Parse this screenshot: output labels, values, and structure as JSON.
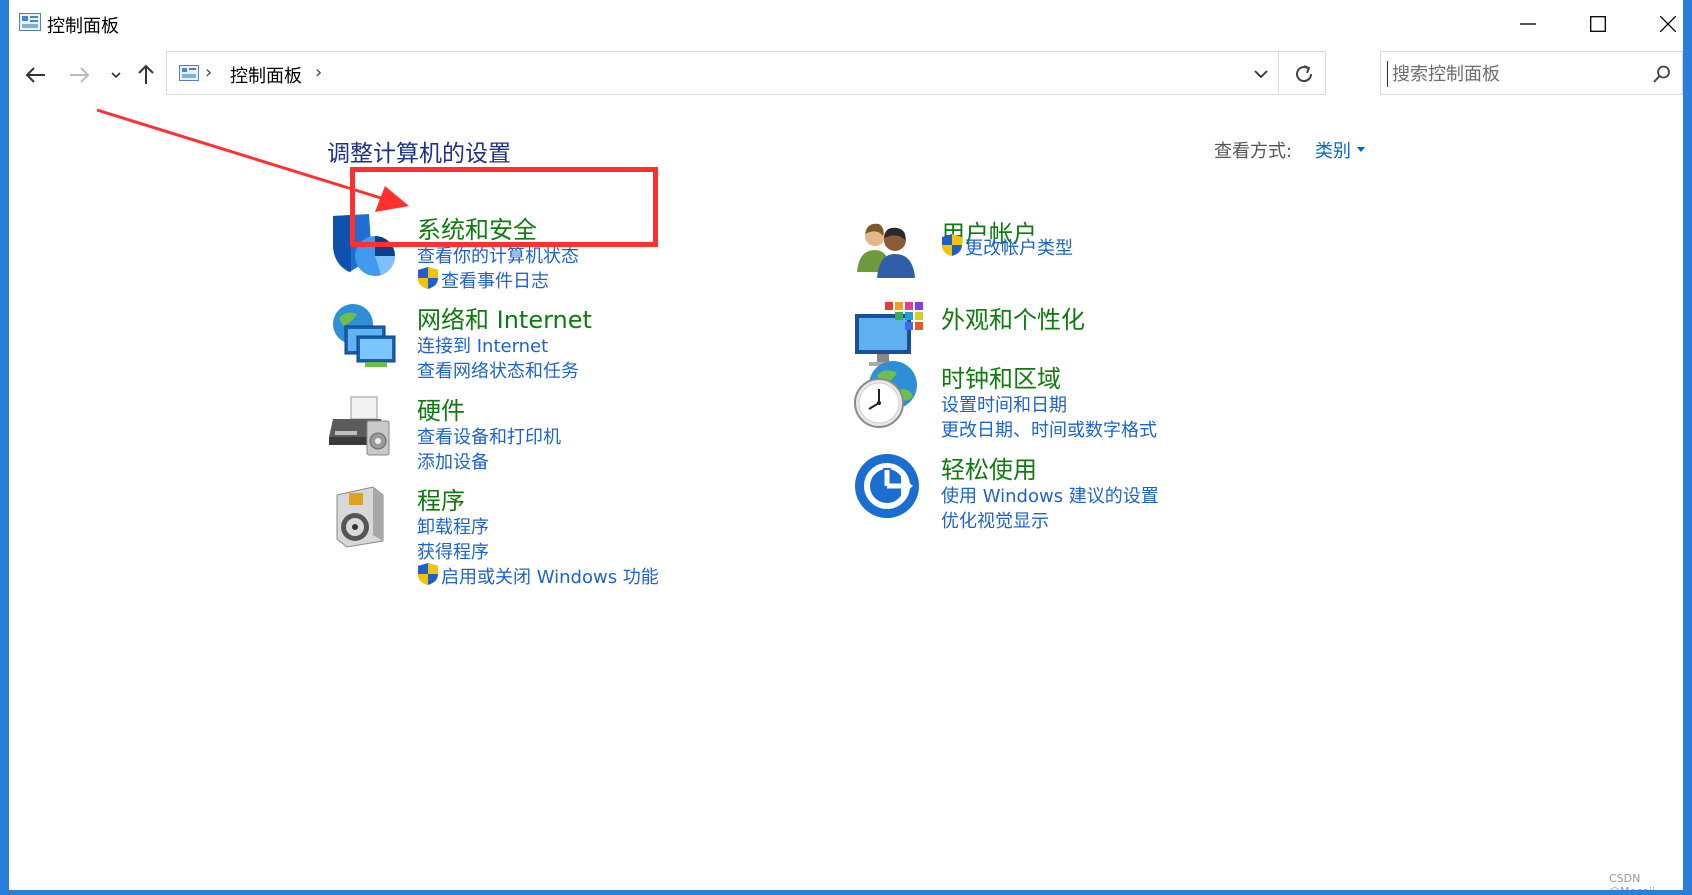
{
  "window": {
    "title": "控制面板",
    "controls": {
      "minimize": "minimize",
      "maximize": "maximize",
      "close": "close"
    }
  },
  "navbar": {
    "breadcrumb": "控制面板",
    "search_placeholder": "搜索控制面板"
  },
  "main": {
    "heading": "调整计算机的设置",
    "view_by_label": "查看方式:",
    "view_by_value": "类别"
  },
  "categories": [
    {
      "title": "系统和安全",
      "icon": "system-security-icon",
      "links": [
        {
          "label": "查看你的计算机状态",
          "shield": false
        },
        {
          "label": "查看事件日志",
          "shield": true
        }
      ]
    },
    {
      "title": "网络和 Internet",
      "icon": "network-internet-icon",
      "links": [
        {
          "label": "连接到 Internet",
          "shield": false
        },
        {
          "label": "查看网络状态和任务",
          "shield": false
        }
      ]
    },
    {
      "title": "硬件",
      "icon": "hardware-printer-icon",
      "links": [
        {
          "label": "查看设备和打印机",
          "shield": false
        },
        {
          "label": "添加设备",
          "shield": false
        }
      ]
    },
    {
      "title": "程序",
      "icon": "programs-icon",
      "links": [
        {
          "label": "卸载程序",
          "shield": false
        },
        {
          "label": "获得程序",
          "shield": false
        },
        {
          "label": "启用或关闭 Windows 功能",
          "shield": true
        }
      ]
    },
    {
      "title": "用户帐户",
      "icon": "user-accounts-icon",
      "links": [
        {
          "label": "更改帐户类型",
          "shield": true
        }
      ]
    },
    {
      "title": "外观和个性化",
      "icon": "appearance-icon",
      "links": []
    },
    {
      "title": "时钟和区域",
      "icon": "clock-region-icon",
      "links": [
        {
          "label": "设置时间和日期",
          "shield": false
        },
        {
          "label": "更改日期、时间或数字格式",
          "shield": false
        }
      ]
    },
    {
      "title": "轻松使用",
      "icon": "ease-of-access-icon",
      "links": [
        {
          "label": "使用 Windows 建议的设置",
          "shield": false
        },
        {
          "label": "优化视觉显示",
          "shield": false
        }
      ]
    }
  ],
  "colors": {
    "category_title": "#0f7b0f",
    "link": "#1e64c8",
    "heading": "#1e3287",
    "annotation": "#ff3030"
  },
  "watermark": "CSDN @Mecojj"
}
